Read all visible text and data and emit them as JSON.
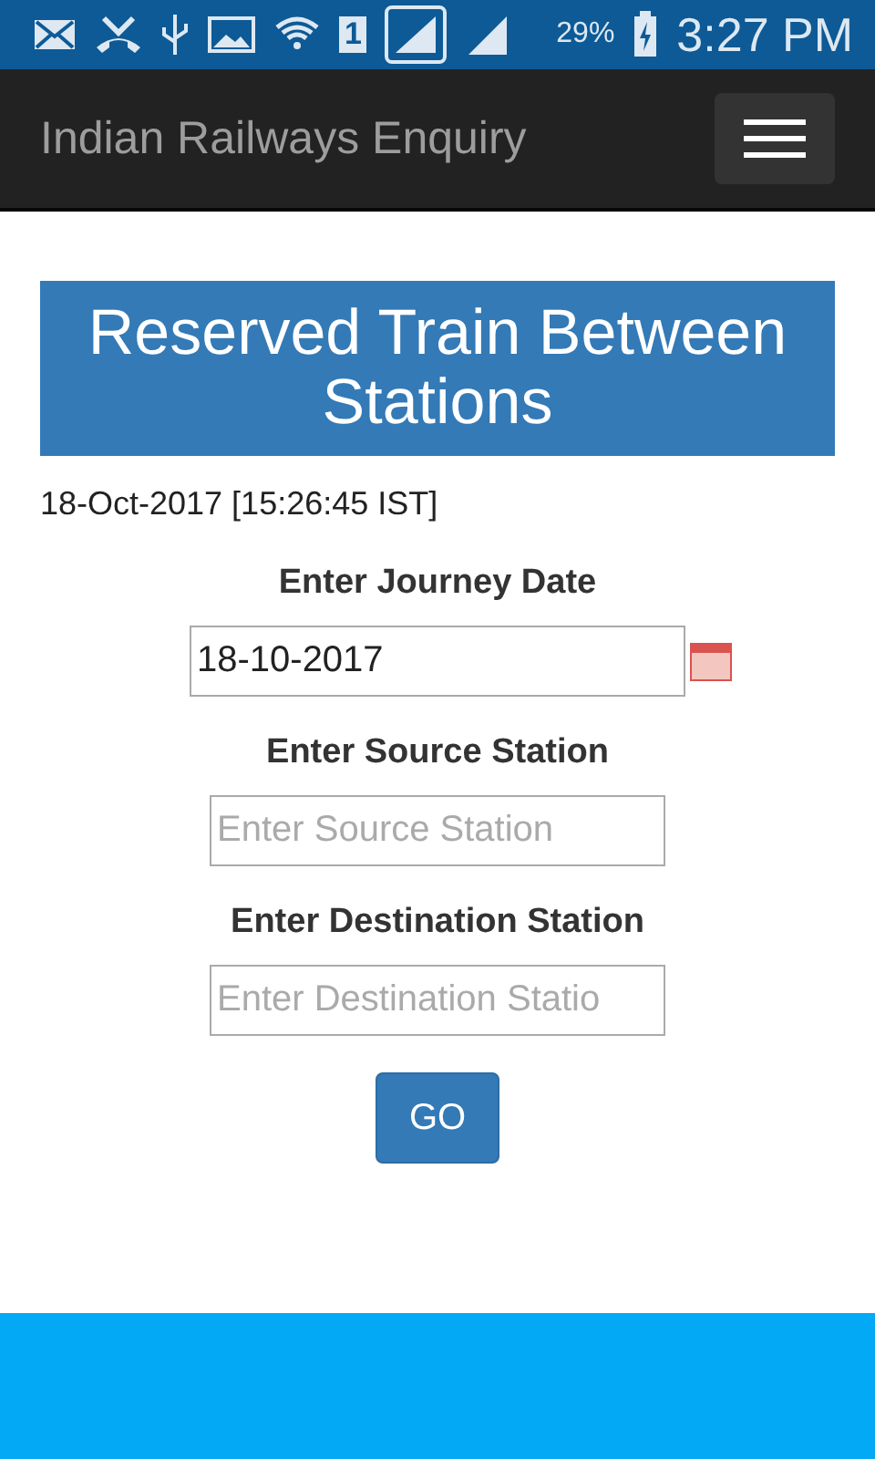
{
  "status_bar": {
    "sim": "1",
    "battery": "29%",
    "time": "3:27 PM"
  },
  "navbar": {
    "title": "Indian Railways Enquiry"
  },
  "banner": {
    "title": "Reserved Train Between Stations"
  },
  "timestamp": "18-Oct-2017 [15:26:45 IST]",
  "form": [
    {
      "label": "Enter Journey Date",
      "value": "18-10-2017",
      "kind": "date"
    },
    {
      "label": "Enter Source Station",
      "placeholder": "Enter Source Station",
      "kind": "text"
    },
    {
      "label": "Enter Destination Station",
      "placeholder": "Enter Destination Statio",
      "kind": "text"
    }
  ],
  "go_button": "GO"
}
